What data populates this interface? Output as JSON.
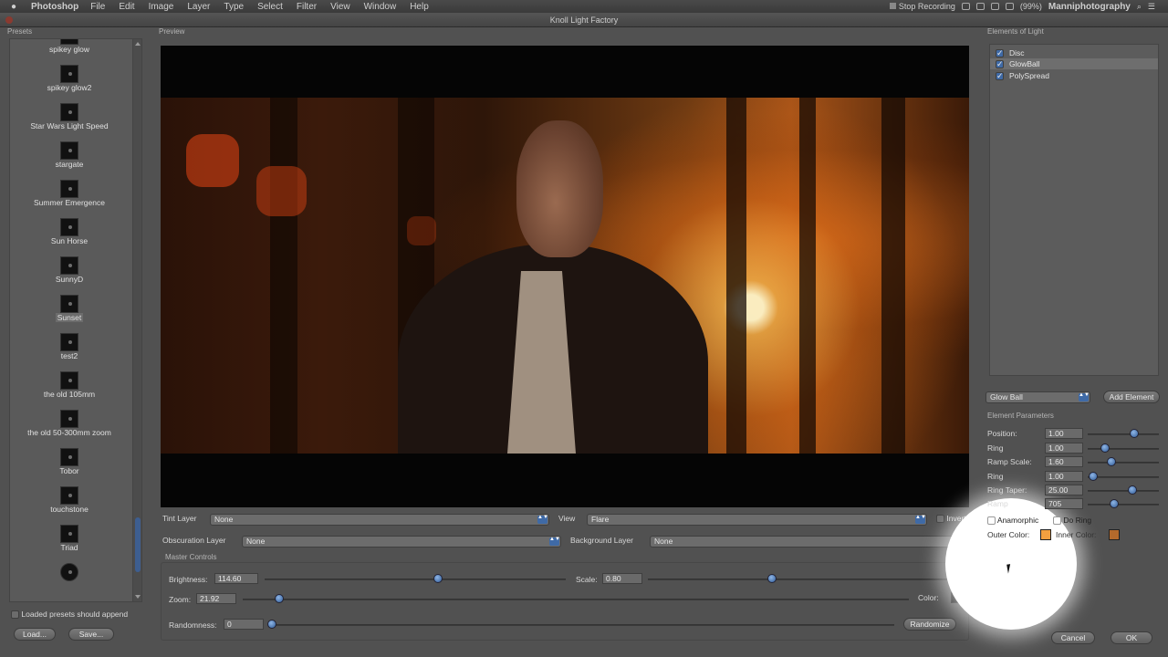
{
  "menubar": {
    "app_name": "Photoshop",
    "items": [
      "File",
      "Edit",
      "Image",
      "Layer",
      "Type",
      "Select",
      "Filter",
      "View",
      "Window",
      "Help"
    ],
    "stop_recording": "Stop Recording",
    "battery": "(99%)",
    "user": "Manniphotography"
  },
  "window": {
    "title": "Knoll Light Factory"
  },
  "panels": {
    "presets_label": "Presets",
    "preview_label": "Preview",
    "elements_label": "Elements of Light",
    "element_params_label": "Element Parameters",
    "master_controls_label": "Master Controls"
  },
  "presets": {
    "items": [
      {
        "name": "spikey glow",
        "selected": false
      },
      {
        "name": "spikey glow2",
        "selected": false
      },
      {
        "name": "Star Wars Light Speed",
        "selected": false
      },
      {
        "name": "stargate",
        "selected": false
      },
      {
        "name": "Summer Emergence",
        "selected": false
      },
      {
        "name": "Sun Horse",
        "selected": false
      },
      {
        "name": "SunnyD",
        "selected": false
      },
      {
        "name": "Sunset",
        "selected": true
      },
      {
        "name": "test2",
        "selected": false
      },
      {
        "name": "the old 105mm",
        "selected": false
      },
      {
        "name": "the old 50-300mm zoom",
        "selected": false
      },
      {
        "name": "Tobor",
        "selected": false
      },
      {
        "name": "touchstone",
        "selected": false
      },
      {
        "name": "Triad",
        "selected": false
      }
    ],
    "append_label": "Loaded presets should append",
    "load_button": "Load...",
    "save_button": "Save..."
  },
  "layers": {
    "tint_label": "Tint Layer",
    "tint_value": "None",
    "view_label": "View",
    "view_value": "Flare",
    "invert_label": "Invert",
    "obscuration_label": "Obscuration Layer",
    "obscuration_value": "None",
    "background_label": "Background Layer",
    "background_value": "None"
  },
  "master": {
    "brightness_label": "Brightness:",
    "brightness_value": "114.60",
    "scale_label": "Scale:",
    "scale_value": "0.80",
    "zoom_label": "Zoom:",
    "zoom_value": "21.92",
    "color_label": "Color:",
    "randomness_label": "Randomness:",
    "randomness_value": "0",
    "randomize_button": "Randomize"
  },
  "elements": {
    "items": [
      {
        "name": "Disc",
        "checked": true,
        "selected": false
      },
      {
        "name": "GlowBall",
        "checked": true,
        "selected": true
      },
      {
        "name": "PolySpread",
        "checked": true,
        "selected": false
      }
    ],
    "type_select": "Glow Ball",
    "add_button": "Add Element"
  },
  "params": {
    "position_label": "Position:",
    "position_value": "1.00",
    "ring1_label": "Ring",
    "ring1_value": "1.00",
    "ramp_scale_label": "Ramp Scale:",
    "ramp_scale_value": "1.60",
    "ring2_label": "Ring",
    "ring2_value": "1.00",
    "ring_taper_label": "Ring Taper:",
    "ring_taper_value": "25.00",
    "ramp_label": "Ramp",
    "ramp_value": "705",
    "anamorphic_label": "Anamorphic",
    "do_ring_label": "Do Ring",
    "outer_color_label": "Outer Color:",
    "inner_color_label": "Inner Color:",
    "outer_color": "#f2a040",
    "inner_color": "#b46a2c"
  },
  "footer": {
    "cancel_button": "Cancel",
    "ok_button": "OK"
  },
  "colors": {
    "accent": "#3f6aa6",
    "master_color": "#111111"
  }
}
